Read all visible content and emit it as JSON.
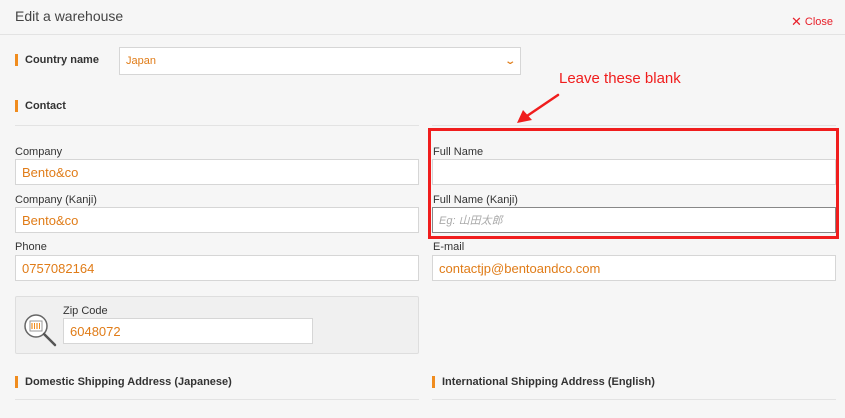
{
  "modal": {
    "title": "Edit a warehouse",
    "close_label": "Close"
  },
  "country": {
    "section_label": "Country name",
    "selected": "Japan"
  },
  "contact": {
    "section_label": "Contact",
    "company_label": "Company",
    "company_value": "Bento&co",
    "company_kanji_label": "Company (Kanji)",
    "company_kanji_value": "Bento&co",
    "phone_label": "Phone",
    "phone_value": "0757082164",
    "full_name_label": "Full Name",
    "full_name_value": "",
    "full_name_kanji_label": "Full Name (Kanji)",
    "full_name_kanji_placeholder": "Eg: 山田太郎",
    "email_label": "E-mail",
    "email_value": "contactjp@bentoandco.com"
  },
  "zip": {
    "label": "Zip Code",
    "value": "6048072"
  },
  "addresses": {
    "domestic_label": "Domestic Shipping Address (Japanese)",
    "international_label": "International Shipping Address (English)"
  },
  "annotation": {
    "text": "Leave these blank"
  },
  "colors": {
    "accent": "#f08c1e",
    "value_text": "#e07c18",
    "annotation_red": "#f01d1d"
  }
}
